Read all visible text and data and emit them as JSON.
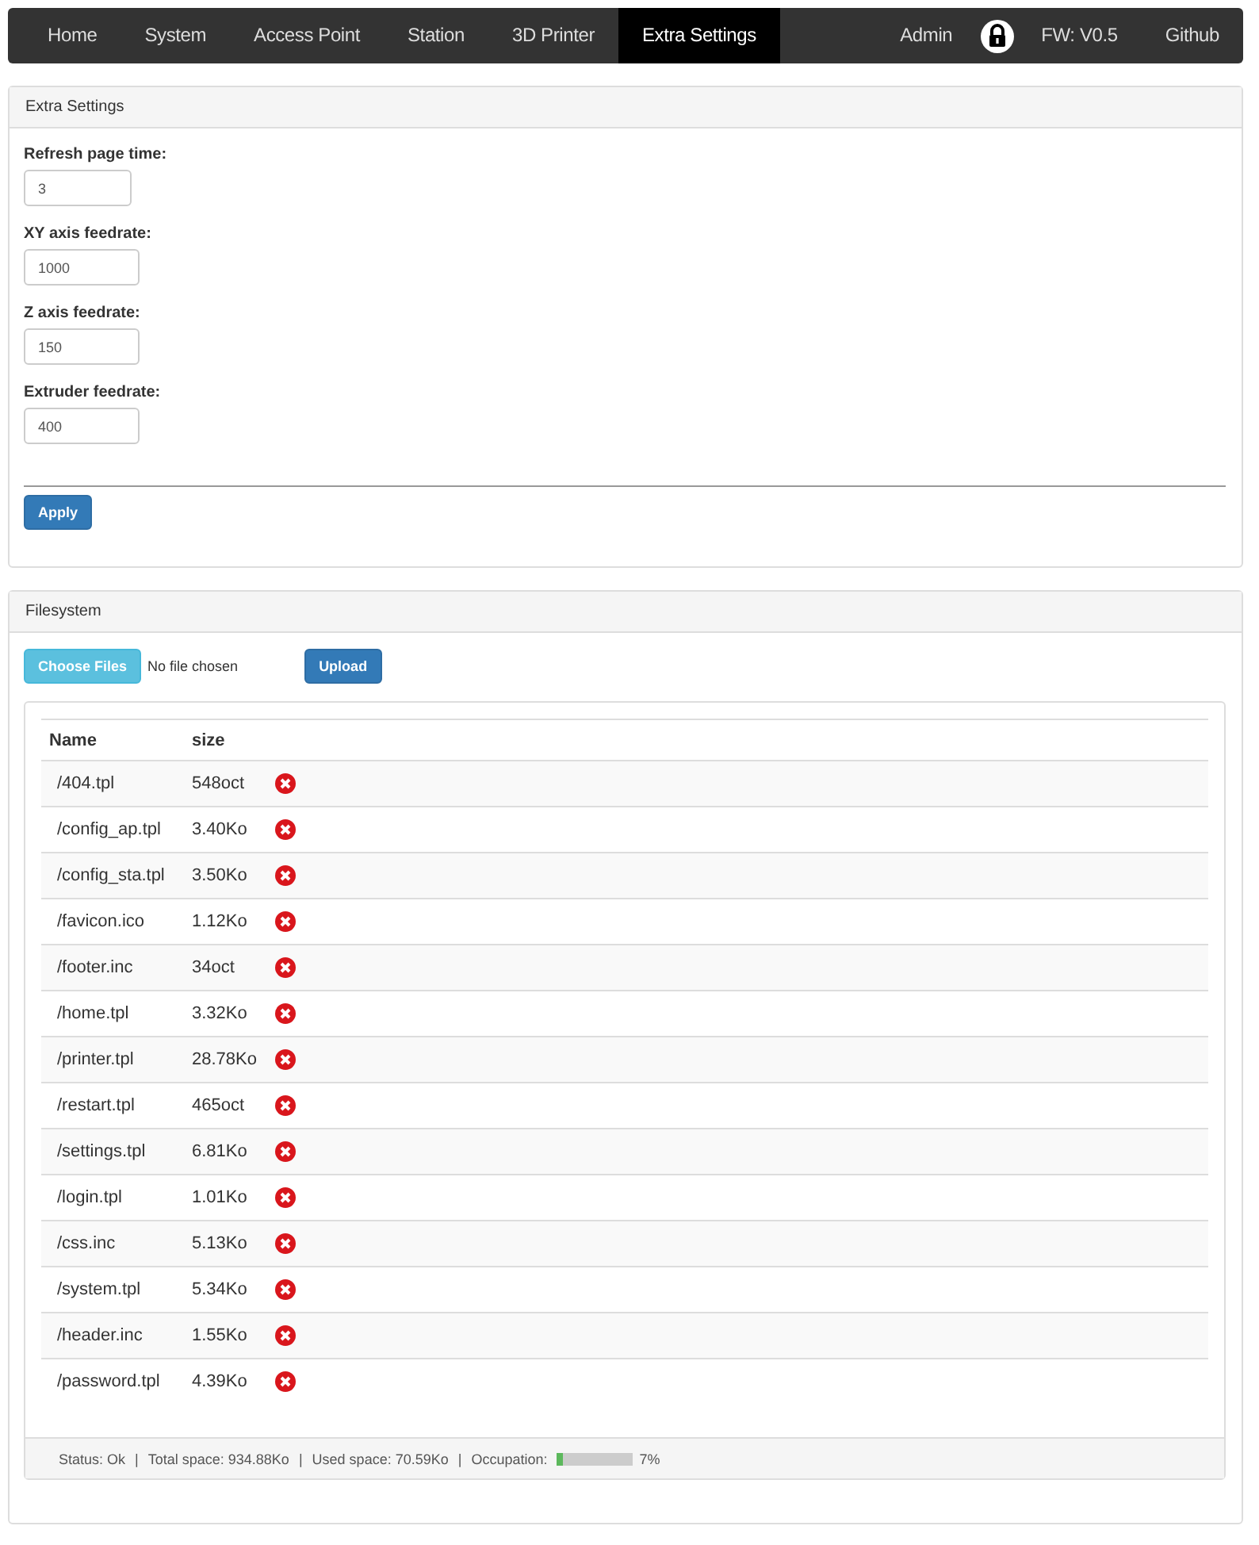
{
  "navbar": {
    "items": [
      {
        "label": "Home",
        "selected": false
      },
      {
        "label": "System",
        "selected": false
      },
      {
        "label": "Access Point",
        "selected": false
      },
      {
        "label": "Station",
        "selected": false
      },
      {
        "label": "3D Printer",
        "selected": false
      },
      {
        "label": "Extra Settings",
        "selected": true
      }
    ],
    "right": [
      "Admin",
      "FW: V0.5",
      "Github"
    ]
  },
  "settings_panel": {
    "title": "Extra Settings",
    "fields": [
      {
        "label": "Refresh page time:",
        "value": "3"
      },
      {
        "label": "XY axis feedrate:",
        "value": "1000"
      },
      {
        "label": "Z axis feedrate:",
        "value": "150"
      },
      {
        "label": "Extruder feedrate:",
        "value": "400"
      }
    ],
    "button": "Apply"
  },
  "filesystem_panel": {
    "title": "Filesystem",
    "choose_button": "Choose Files",
    "no_file": "No file chosen",
    "upload_button": "Upload",
    "table": {
      "columns": [
        "Name",
        "size"
      ],
      "rows": [
        {
          "name": "/404.tpl",
          "size": "548oct"
        },
        {
          "name": "/config_ap.tpl",
          "size": "3.40Ko"
        },
        {
          "name": "/config_sta.tpl",
          "size": "3.50Ko"
        },
        {
          "name": "/favicon.ico",
          "size": "1.12Ko"
        },
        {
          "name": "/footer.inc",
          "size": "34oct"
        },
        {
          "name": "/home.tpl",
          "size": "3.32Ko"
        },
        {
          "name": "/printer.tpl",
          "size": "28.78Ko"
        },
        {
          "name": "/restart.tpl",
          "size": "465oct"
        },
        {
          "name": "/settings.tpl",
          "size": "6.81Ko"
        },
        {
          "name": "/login.tpl",
          "size": "1.01Ko"
        },
        {
          "name": "/css.inc",
          "size": "5.13Ko"
        },
        {
          "name": "/system.tpl",
          "size": "5.34Ko"
        },
        {
          "name": "/header.inc",
          "size": "1.55Ko"
        },
        {
          "name": "/password.tpl",
          "size": "4.39Ko"
        }
      ]
    },
    "status_bar": {
      "separator": "|",
      "items": [
        "Status: Ok",
        "Total space: 934.88Ko",
        "Used space: 70.59Ko",
        "Occupation:"
      ],
      "occupation": {
        "level": 0.07,
        "reading": "7%"
      }
    }
  }
}
